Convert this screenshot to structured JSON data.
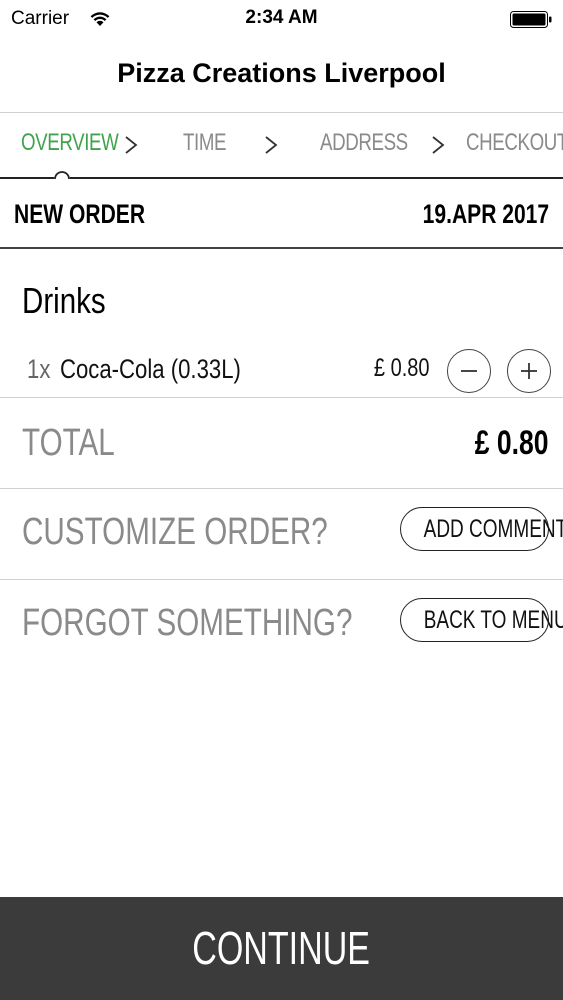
{
  "status_bar": {
    "carrier": "Carrier",
    "time": "2:34 AM",
    "wifi_icon": "wifi-icon",
    "battery_icon": "battery-icon"
  },
  "nav": {
    "title": "Pizza Creations Liverpool"
  },
  "steps": [
    {
      "label": "OVERVIEW",
      "active": true
    },
    {
      "label": "TIME",
      "active": false
    },
    {
      "label": "ADDRESS",
      "active": false
    },
    {
      "label": "CHECKOUT",
      "active": false
    }
  ],
  "order": {
    "heading": "NEW ORDER",
    "date": "19.APR 2017"
  },
  "section": {
    "title": "Drinks"
  },
  "items": [
    {
      "qty": "1x",
      "name": "Coca-Cola (0.33L)",
      "price": "£ 0.80"
    }
  ],
  "total": {
    "label": "TOTAL",
    "value": "£ 0.80"
  },
  "customize": {
    "label": "CUSTOMIZE ORDER?",
    "button": "ADD COMMENT"
  },
  "forgot": {
    "label": "FORGOT SOMETHING?",
    "button": "BACK TO MENU"
  },
  "footer": {
    "continue_label": "CONTINUE"
  },
  "colors": {
    "active_step": "#3fa34d",
    "inactive_text": "#8a8a8a",
    "continue_bg": "#3c3b3b"
  }
}
